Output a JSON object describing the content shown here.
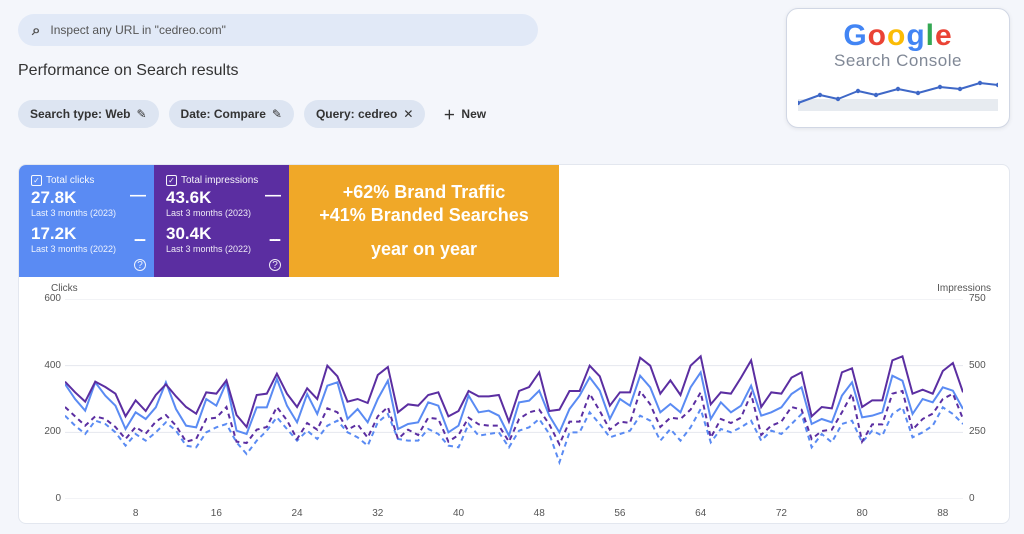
{
  "search": {
    "placeholder": "Inspect any URL in \"cedreo.com\""
  },
  "page_title": "Performance on Search results",
  "filters": {
    "chips": [
      {
        "label": "Search type: Web",
        "icon": "pencil"
      },
      {
        "label": "Date: Compare",
        "icon": "pencil"
      },
      {
        "label": "Query: cedreo",
        "icon": "close"
      }
    ],
    "new_label": "New"
  },
  "brand": {
    "name": "Google",
    "sub": "Search Console"
  },
  "metrics": {
    "clicks": {
      "label": "Total clicks",
      "v1": "27.8K",
      "sub1": "Last 3 months (2023)",
      "v2": "17.2K",
      "sub2": "Last 3 months (2022)"
    },
    "impressions": {
      "label": "Total impressions",
      "v1": "43.6K",
      "sub1": "Last 3 months (2023)",
      "v2": "30.4K",
      "sub2": "Last 3 months (2022)"
    }
  },
  "callout": {
    "line1": "+62% Brand Traffic",
    "line2": "+41% Branded Searches",
    "line3": "year on year"
  },
  "chart_data": {
    "type": "line",
    "left_axis": {
      "label": "Clicks",
      "ticks": [
        0,
        200,
        400,
        600
      ]
    },
    "right_axis": {
      "label": "Impressions",
      "ticks": [
        0,
        250,
        500,
        750
      ]
    },
    "x_ticks": [
      8,
      16,
      24,
      32,
      40,
      48,
      56,
      64,
      72,
      80,
      88
    ],
    "x_range": [
      1,
      90
    ],
    "series": [
      {
        "name": "Clicks 2023",
        "axis": "left",
        "style": "solid",
        "color": "#5a8bf3",
        "values": [
          345,
          300,
          265,
          350,
          310,
          280,
          210,
          260,
          240,
          275,
          350,
          270,
          220,
          215,
          300,
          280,
          350,
          205,
          195,
          275,
          275,
          360,
          280,
          230,
          315,
          255,
          340,
          350,
          240,
          270,
          230,
          300,
          355,
          210,
          225,
          230,
          290,
          280,
          200,
          220,
          310,
          260,
          265,
          250,
          190,
          290,
          295,
          325,
          250,
          200,
          270,
          310,
          365,
          325,
          240,
          300,
          280,
          370,
          335,
          260,
          285,
          260,
          335,
          380,
          240,
          290,
          260,
          280,
          340,
          250,
          260,
          275,
          315,
          335,
          225,
          240,
          230,
          310,
          350,
          245,
          250,
          260,
          370,
          355,
          255,
          300,
          290,
          335,
          325,
          270
        ]
      },
      {
        "name": "Clicks 2022",
        "axis": "left",
        "style": "dashed",
        "color": "#5a8bf3",
        "values": [
          250,
          220,
          195,
          235,
          225,
          200,
          160,
          195,
          175,
          200,
          230,
          205,
          160,
          155,
          200,
          215,
          225,
          170,
          135,
          175,
          205,
          245,
          210,
          175,
          205,
          180,
          220,
          235,
          200,
          185,
          160,
          230,
          255,
          180,
          175,
          175,
          210,
          195,
          160,
          155,
          225,
          190,
          195,
          200,
          155,
          205,
          215,
          240,
          195,
          110,
          200,
          200,
          260,
          225,
          185,
          195,
          205,
          250,
          235,
          175,
          210,
          175,
          215,
          270,
          170,
          210,
          200,
          215,
          235,
          175,
          205,
          195,
          225,
          255,
          155,
          195,
          170,
          225,
          235,
          170,
          205,
          190,
          255,
          275,
          185,
          200,
          220,
          275,
          255,
          225
        ]
      },
      {
        "name": "Impressions 2023",
        "axis": "right",
        "style": "solid",
        "color": "#5b2ea1",
        "values": [
          440,
          400,
          365,
          440,
          420,
          395,
          310,
          370,
          330,
          390,
          430,
          385,
          345,
          320,
          400,
          395,
          445,
          315,
          270,
          390,
          395,
          470,
          395,
          345,
          415,
          375,
          500,
          460,
          365,
          375,
          360,
          465,
          495,
          325,
          355,
          350,
          390,
          400,
          310,
          330,
          405,
          385,
          385,
          390,
          290,
          405,
          420,
          475,
          330,
          335,
          405,
          405,
          500,
          460,
          350,
          400,
          400,
          530,
          500,
          395,
          445,
          390,
          500,
          535,
          355,
          400,
          395,
          455,
          520,
          345,
          400,
          395,
          455,
          475,
          310,
          345,
          340,
          475,
          490,
          345,
          370,
          370,
          520,
          535,
          395,
          410,
          395,
          480,
          510,
          400
        ]
      },
      {
        "name": "Impressions 2022",
        "axis": "right",
        "style": "dashed",
        "color": "#5b2ea1",
        "values": [
          345,
          310,
          275,
          310,
          300,
          270,
          225,
          270,
          245,
          290,
          315,
          275,
          215,
          225,
          300,
          305,
          345,
          215,
          210,
          260,
          270,
          345,
          295,
          225,
          285,
          260,
          340,
          325,
          260,
          280,
          230,
          310,
          345,
          225,
          260,
          240,
          305,
          300,
          215,
          240,
          305,
          280,
          275,
          275,
          215,
          300,
          325,
          335,
          280,
          205,
          290,
          290,
          395,
          330,
          260,
          290,
          285,
          405,
          355,
          270,
          305,
          300,
          335,
          400,
          230,
          300,
          285,
          305,
          395,
          240,
          275,
          290,
          345,
          335,
          225,
          255,
          260,
          325,
          395,
          215,
          280,
          280,
          395,
          405,
          260,
          300,
          320,
          375,
          395,
          300
        ]
      }
    ]
  }
}
